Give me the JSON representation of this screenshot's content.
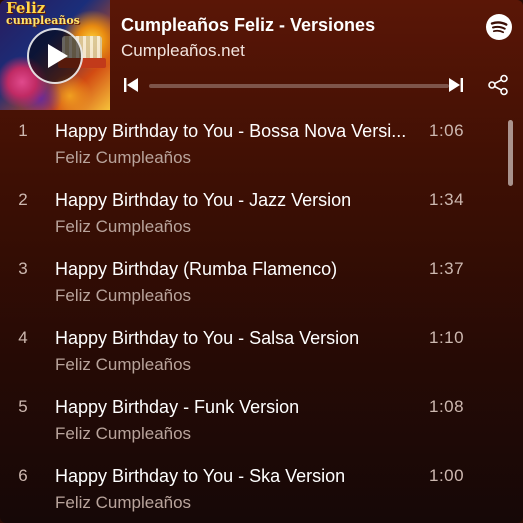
{
  "header": {
    "cover": {
      "word1": "Feliz",
      "word2": "cumpleaños"
    },
    "title": "Cumpleaños Feliz - Versiones",
    "artist": "Cumpleaños.net",
    "progress_fraction": 0.0
  },
  "icons": {
    "play": "play-icon",
    "spotify": "spotify-logo-icon",
    "previous": "skip-previous-icon",
    "next": "skip-next-icon",
    "share": "share-icon"
  },
  "tracks": [
    {
      "num": "1",
      "title": "Happy Birthday to You - Bossa Nova Versi...",
      "artist": "Feliz Cumpleaños",
      "duration": "1:06"
    },
    {
      "num": "2",
      "title": "Happy Birthday to You - Jazz Version",
      "artist": "Feliz Cumpleaños",
      "duration": "1:34"
    },
    {
      "num": "3",
      "title": "Happy Birthday (Rumba Flamenco)",
      "artist": "Feliz Cumpleaños",
      "duration": "1:37"
    },
    {
      "num": "4",
      "title": "Happy Birthday to You - Salsa Version",
      "artist": "Feliz Cumpleaños",
      "duration": "1:10"
    },
    {
      "num": "5",
      "title": "Happy Birthday - Funk Version",
      "artist": "Feliz Cumpleaños",
      "duration": "1:08"
    },
    {
      "num": "6",
      "title": "Happy Birthday to You - Ska Version",
      "artist": "Feliz Cumpleaños",
      "duration": "1:00"
    }
  ]
}
